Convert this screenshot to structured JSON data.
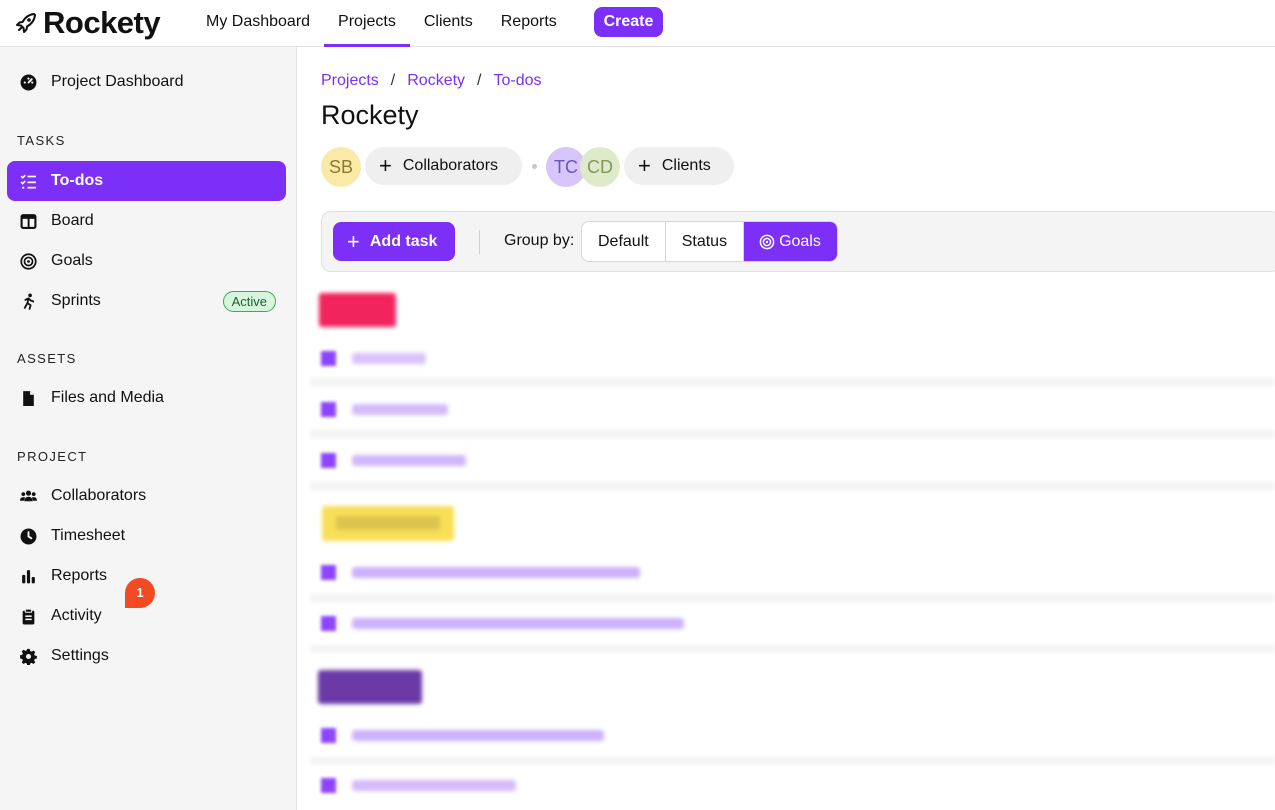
{
  "app": {
    "name": "Rockety"
  },
  "nav": {
    "items": [
      "My Dashboard",
      "Projects",
      "Clients",
      "Reports"
    ],
    "active": "Projects",
    "create_label": "Create"
  },
  "sidebar": {
    "top_item": {
      "label": "Project Dashboard",
      "icon": "dashboard-icon"
    },
    "sections": {
      "tasks": "TASKS",
      "assets": "ASSETS",
      "project": "PROJECT"
    },
    "tasks_items": [
      {
        "label": "To-dos",
        "icon": "checklist-icon",
        "active": true
      },
      {
        "label": "Board",
        "icon": "board-icon"
      },
      {
        "label": "Goals",
        "icon": "target-icon"
      },
      {
        "label": "Sprints",
        "icon": "runner-icon",
        "badge": "Active"
      }
    ],
    "assets_items": [
      {
        "label": "Files and Media",
        "icon": "file-icon"
      }
    ],
    "project_items": [
      {
        "label": "Collaborators",
        "icon": "users-icon"
      },
      {
        "label": "Timesheet",
        "icon": "clock-icon"
      },
      {
        "label": "Reports",
        "icon": "bar-chart-icon"
      },
      {
        "label": "Activity",
        "icon": "clipboard-icon"
      },
      {
        "label": "Settings",
        "icon": "gear-icon",
        "notification_count": "1"
      }
    ]
  },
  "breadcrumb": [
    "Projects",
    "Rockety",
    "To-dos"
  ],
  "page": {
    "title": "Rockety",
    "collaborator_avatars": [
      "SB"
    ],
    "collaborators_button": "Collaborators",
    "client_avatars": [
      "TC",
      "CD"
    ],
    "clients_button": "Clients"
  },
  "toolbar": {
    "add_task_label": "Add task",
    "group_by_label": "Group by:",
    "group_options": [
      "Default",
      "Status",
      "Goals"
    ],
    "group_selected": "Goals"
  },
  "colors": {
    "accent": "#7c2ff7",
    "goal_1": "#f0185a",
    "goal_2": "#f5d53a",
    "goal_3": "#5a2a9a",
    "notification": "#f24b24"
  }
}
